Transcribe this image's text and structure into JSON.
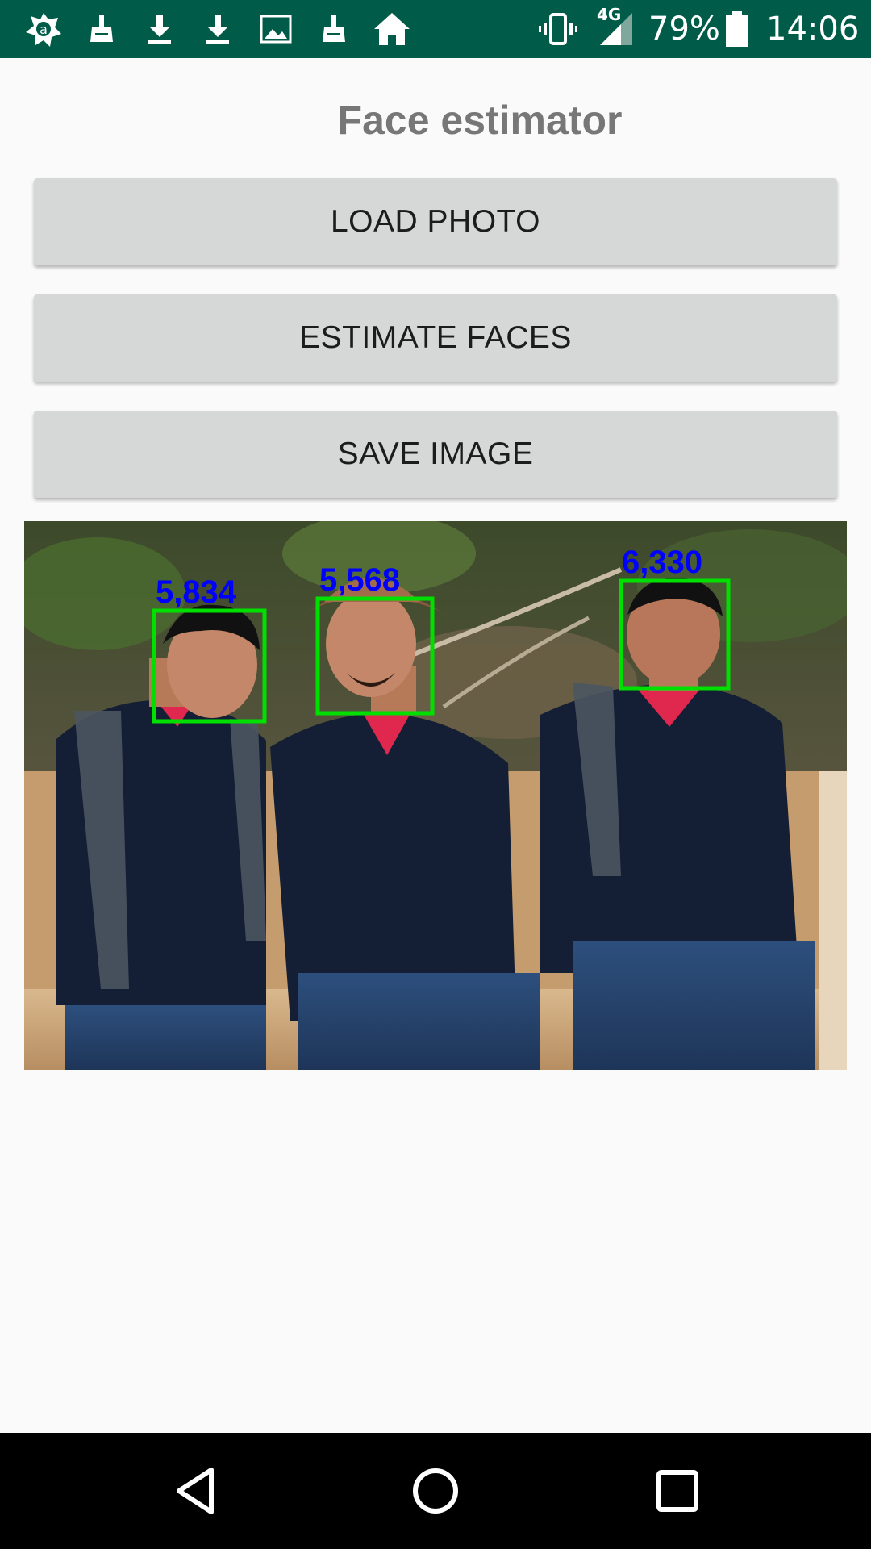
{
  "status_bar": {
    "battery_text": "79%",
    "network_text": "4G",
    "clock": "14:06",
    "left_icons": [
      "app-logo-icon",
      "broom-icon",
      "download-icon",
      "download-icon",
      "image-icon",
      "broom-icon",
      "home-icon"
    ],
    "right_icons": [
      "vibrate-icon",
      "signal-icon",
      "battery-icon"
    ]
  },
  "app": {
    "title": "Face estimator"
  },
  "buttons": {
    "load": "LOAD PHOTO",
    "estimate": "ESTIMATE FACES",
    "save": "SAVE IMAGE"
  },
  "photo": {
    "face_labels": [
      "5,834",
      "5,568",
      "6,330"
    ],
    "box_color": "#00e000",
    "label_color": "#0000ff"
  },
  "nav": {
    "icons": [
      "back-icon",
      "home-circle-icon",
      "recents-icon"
    ]
  },
  "colors": {
    "status_bar_bg": "#005b48",
    "button_bg": "#d6d7d7",
    "title_color": "#777777",
    "page_bg": "#fafafa"
  }
}
